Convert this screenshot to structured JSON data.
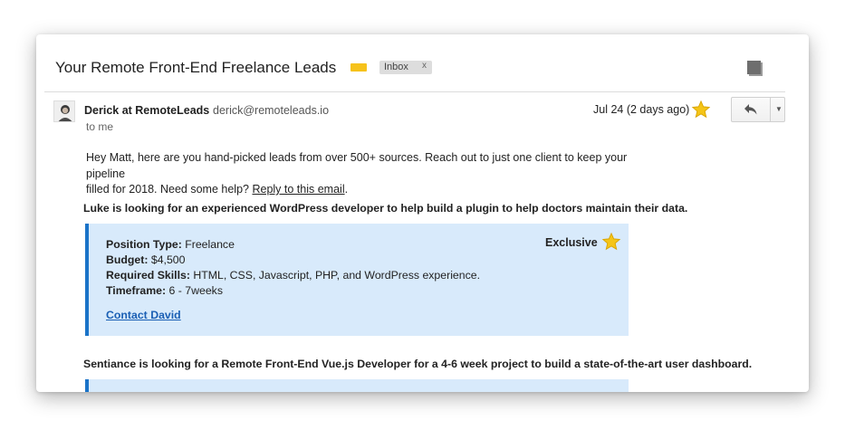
{
  "email": {
    "subject": "Your Remote Front-End Freelance Leads",
    "inbox_label": "Inbox",
    "inbox_remove": "x",
    "label_color": "#f6c21b",
    "sender": {
      "name": "Derick at RemoteLeads",
      "email": "derick@remoteleads.io",
      "to": "to me",
      "date": "Jul 24 (2 days ago)",
      "starred": true
    },
    "actions": {
      "reply_icon": "reply-icon",
      "more_icon": "chevron-down-icon",
      "print_icon": "print-icon"
    },
    "intro": {
      "line1": "Hey Matt, here are you hand-picked leads from over 500+ sources. Reach out to just one client to keep your pipeline",
      "line2_prefix": "filled for 2018. Need some help?",
      "reply_link": "Reply to this email",
      "line2_suffix": "."
    },
    "leads": [
      {
        "title": "Luke is looking for an experienced WordPress developer to help build a plugin to help doctors maintain their data.",
        "exclusive": "Exclusive",
        "fields": [
          {
            "label": "Position Type:",
            "value": "Freelance"
          },
          {
            "label": "Budget:",
            "value": "$4,500"
          },
          {
            "label": "Required Skills:",
            "value": "HTML, CSS, Javascript, PHP, and WordPress experience."
          },
          {
            "label": "Timeframe:",
            "value": "6 - 7weeks"
          }
        ],
        "contact": "Contact David"
      },
      {
        "title": "Sentiance is looking for a Remote Front-End Vue.js Developer for a 4-6 week project to build a state-of-the-art user dashboard."
      }
    ],
    "colors": {
      "card_bg": "#d8eafb",
      "card_border": "#1a73c8",
      "star": "#f5c518",
      "link": "#1a5fb4"
    }
  }
}
